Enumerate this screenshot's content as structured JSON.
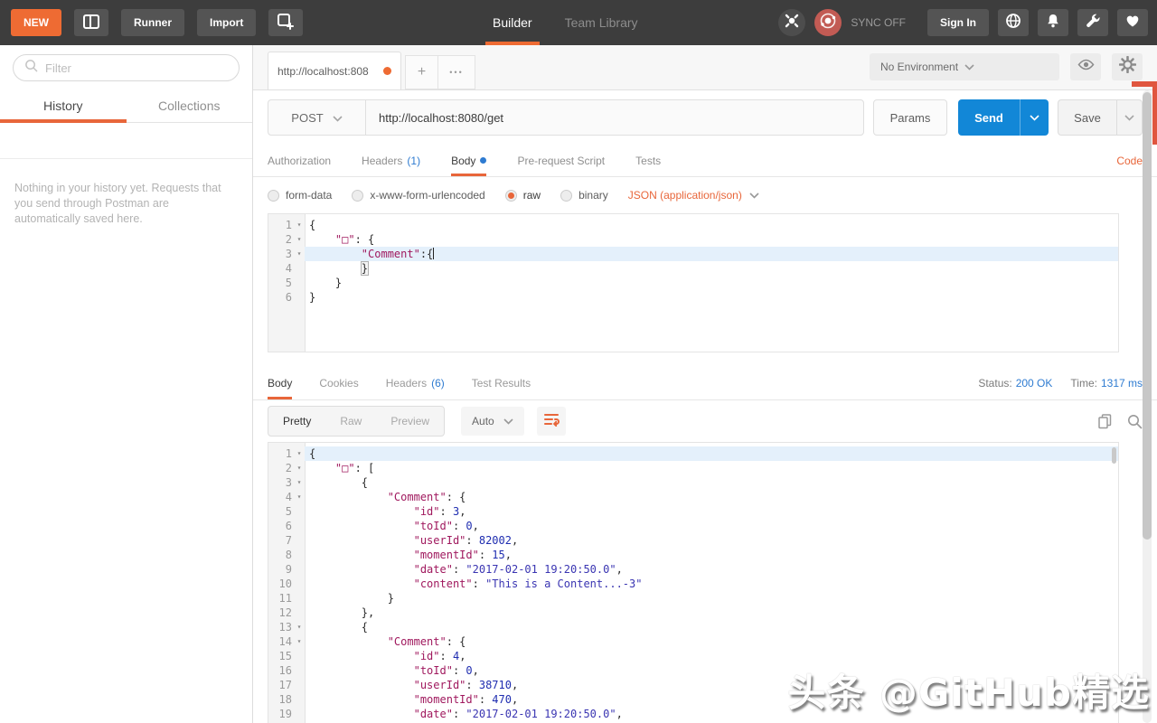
{
  "header": {
    "new_label": "NEW",
    "runner_label": "Runner",
    "import_label": "Import",
    "builder_tab": "Builder",
    "team_library_tab": "Team Library",
    "sync_label": "SYNC OFF",
    "sign_in_label": "Sign In"
  },
  "sidebar": {
    "filter_placeholder": "Filter",
    "history_tab": "History",
    "collections_tab": "Collections",
    "empty_message": "Nothing in your history yet. Requests that you send through Postman are automatically saved here."
  },
  "topbar": {
    "request_tab_title": "http://localhost:808",
    "plus_label": "+",
    "more_label": "•••",
    "environment": "No Environment"
  },
  "request": {
    "method": "POST",
    "url": "http://localhost:8080/get",
    "params_label": "Params",
    "send_label": "Send",
    "save_label": "Save",
    "tabs": {
      "authorization": "Authorization",
      "headers": "Headers",
      "headers_count": "(1)",
      "body": "Body",
      "pre_request": "Pre-request Script",
      "tests": "Tests"
    },
    "code_link": "Code",
    "body_modes": {
      "form_data": "form-data",
      "urlencoded": "x-www-form-urlencoded",
      "raw": "raw",
      "binary": "binary"
    },
    "selected_mode": "raw",
    "content_type": "JSON (application/json)",
    "editor_lines": [
      {
        "n": 1,
        "fold": true,
        "segs": [
          [
            "p",
            "{"
          ]
        ]
      },
      {
        "n": 2,
        "fold": true,
        "segs": [
          [
            "p",
            "    "
          ],
          [
            "k",
            "\"□\""
          ],
          [
            "p",
            ": {"
          ]
        ]
      },
      {
        "n": 3,
        "fold": true,
        "active": true,
        "cursor": true,
        "segs": [
          [
            "p",
            "        "
          ],
          [
            "k",
            "\"Comment\""
          ],
          [
            "p",
            ":{"
          ]
        ]
      },
      {
        "n": 4,
        "segs": [
          [
            "p",
            "        "
          ],
          [
            "m",
            "}"
          ]
        ]
      },
      {
        "n": 5,
        "segs": [
          [
            "p",
            "    }"
          ]
        ]
      },
      {
        "n": 6,
        "segs": [
          [
            "p",
            "}"
          ]
        ]
      }
    ]
  },
  "response": {
    "tabs": {
      "body": "Body",
      "cookies": "Cookies",
      "headers": "Headers",
      "headers_count": "(6)",
      "test_results": "Test Results"
    },
    "status_label": "Status:",
    "status_value": "200 OK",
    "time_label": "Time:",
    "time_value": "1317 ms",
    "views": {
      "pretty": "Pretty",
      "raw": "Raw",
      "preview": "Preview"
    },
    "format_selector": "Auto",
    "editor_lines": [
      {
        "n": 1,
        "fold": true,
        "active": true,
        "segs": [
          [
            "p",
            "{"
          ]
        ]
      },
      {
        "n": 2,
        "fold": true,
        "segs": [
          [
            "p",
            "    "
          ],
          [
            "k",
            "\"□\""
          ],
          [
            "p",
            ": ["
          ]
        ]
      },
      {
        "n": 3,
        "fold": true,
        "segs": [
          [
            "p",
            "        {"
          ]
        ]
      },
      {
        "n": 4,
        "fold": true,
        "segs": [
          [
            "p",
            "            "
          ],
          [
            "k",
            "\"Comment\""
          ],
          [
            "p",
            ": {"
          ]
        ]
      },
      {
        "n": 5,
        "segs": [
          [
            "p",
            "                "
          ],
          [
            "k",
            "\"id\""
          ],
          [
            "p",
            ": "
          ],
          [
            "n",
            "3"
          ],
          [
            "p",
            ","
          ]
        ]
      },
      {
        "n": 6,
        "segs": [
          [
            "p",
            "                "
          ],
          [
            "k",
            "\"toId\""
          ],
          [
            "p",
            ": "
          ],
          [
            "n",
            "0"
          ],
          [
            "p",
            ","
          ]
        ]
      },
      {
        "n": 7,
        "segs": [
          [
            "p",
            "                "
          ],
          [
            "k",
            "\"userId\""
          ],
          [
            "p",
            ": "
          ],
          [
            "n",
            "82002"
          ],
          [
            "p",
            ","
          ]
        ]
      },
      {
        "n": 8,
        "segs": [
          [
            "p",
            "                "
          ],
          [
            "k",
            "\"momentId\""
          ],
          [
            "p",
            ": "
          ],
          [
            "n",
            "15"
          ],
          [
            "p",
            ","
          ]
        ]
      },
      {
        "n": 9,
        "segs": [
          [
            "p",
            "                "
          ],
          [
            "k",
            "\"date\""
          ],
          [
            "p",
            ": "
          ],
          [
            "s",
            "\"2017-02-01 19:20:50.0\""
          ],
          [
            "p",
            ","
          ]
        ]
      },
      {
        "n": 10,
        "segs": [
          [
            "p",
            "                "
          ],
          [
            "k",
            "\"content\""
          ],
          [
            "p",
            ": "
          ],
          [
            "s",
            "\"This is a Content...-3\""
          ]
        ]
      },
      {
        "n": 11,
        "segs": [
          [
            "p",
            "            }"
          ]
        ]
      },
      {
        "n": 12,
        "segs": [
          [
            "p",
            "        },"
          ]
        ]
      },
      {
        "n": 13,
        "fold": true,
        "segs": [
          [
            "p",
            "        {"
          ]
        ]
      },
      {
        "n": 14,
        "fold": true,
        "segs": [
          [
            "p",
            "            "
          ],
          [
            "k",
            "\"Comment\""
          ],
          [
            "p",
            ": {"
          ]
        ]
      },
      {
        "n": 15,
        "segs": [
          [
            "p",
            "                "
          ],
          [
            "k",
            "\"id\""
          ],
          [
            "p",
            ": "
          ],
          [
            "n",
            "4"
          ],
          [
            "p",
            ","
          ]
        ]
      },
      {
        "n": 16,
        "segs": [
          [
            "p",
            "                "
          ],
          [
            "k",
            "\"toId\""
          ],
          [
            "p",
            ": "
          ],
          [
            "n",
            "0"
          ],
          [
            "p",
            ","
          ]
        ]
      },
      {
        "n": 17,
        "segs": [
          [
            "p",
            "                "
          ],
          [
            "k",
            "\"userId\""
          ],
          [
            "p",
            ": "
          ],
          [
            "n",
            "38710"
          ],
          [
            "p",
            ","
          ]
        ]
      },
      {
        "n": 18,
        "segs": [
          [
            "p",
            "                "
          ],
          [
            "k",
            "\"momentId\""
          ],
          [
            "p",
            ": "
          ],
          [
            "n",
            "470"
          ],
          [
            "p",
            ","
          ]
        ]
      },
      {
        "n": 19,
        "segs": [
          [
            "p",
            "                "
          ],
          [
            "k",
            "\"date\""
          ],
          [
            "p",
            ": "
          ],
          [
            "s",
            "\"2017-02-01 19:20:50.0\""
          ],
          [
            "p",
            ","
          ]
        ]
      }
    ]
  },
  "editor": {
    "fold_glyph": "▾"
  },
  "colors": {
    "accent_orange": "#ee6b33",
    "underline_orange": "#e8663a",
    "send_blue": "#1287d7",
    "link_blue": "#2e7bd1",
    "sync_red": "#c25b54",
    "code_key": "#a0195e",
    "code_string": "#3a35b2",
    "code_number": "#1f2db0"
  },
  "watermark": "头条 @GitHub精选"
}
